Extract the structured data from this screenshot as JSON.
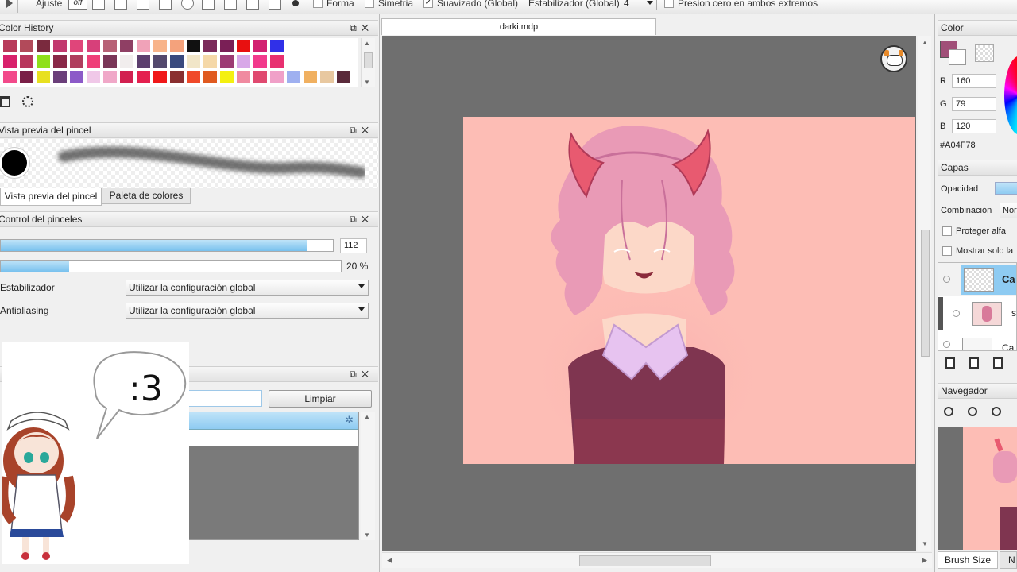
{
  "toolbar": {
    "ajuste": "Ajuste",
    "off": "off",
    "forma": "Forma",
    "simetria": "Simetria",
    "suavizado": "Suavizado (Global)",
    "estabilizador": "Estabilizador (Global)",
    "estabilizador_value": "4",
    "presion": "Presion cero en ambos extremos"
  },
  "color_history": {
    "title": "Color History",
    "colors": [
      [
        "#b83a5a",
        "#b24a5a",
        "#7a2a3e",
        "#c2396f",
        "#e0457a",
        "#d7407a",
        "#b76176",
        "#8f3f64",
        "#f0a2b8",
        "#f8b48a",
        "#f4a27c",
        "#111111",
        "#7b2a5a",
        "#7a1f56",
        "#e81010",
        "#d22070",
        "#3030e8"
      ],
      [
        "#d8216c",
        "#b8365c",
        "#8fe01a",
        "#8a2848",
        "#b03e5e",
        "#ef3f79",
        "#7a3658",
        "#f1eded",
        "#5c3f6e",
        "#54496e",
        "#3a4a7e",
        "#f1e6c8",
        "#f5d8a8",
        "#9d3b74",
        "#d8a8e8",
        "#f23a8c",
        "#e83070"
      ],
      [
        "#f24a8a",
        "#7a1f47",
        "#e8e020",
        "#6b3f7a",
        "#8c5ac8",
        "#f0c8e8",
        "#f0a8c8",
        "#d22050",
        "#e4204f",
        "#f0181a",
        "#8a2f30",
        "#f04a2a",
        "#e05a20",
        "#f4f010",
        "#f08aa0",
        "#e04a70",
        "#f0a0c8",
        "#9fb0f0",
        "#f0b060",
        "#e8c8a0",
        "#5a2a3a"
      ]
    ]
  },
  "brush_preview": {
    "title": "Vista previa del pincel",
    "tab_active": "Vista previa del pincel",
    "tab_other": "Paleta de colores"
  },
  "brush_control": {
    "title": "Control del pinceles",
    "size_value": "112",
    "size_percent": 92,
    "opacity_value": "20 %",
    "opacity_percent": 20,
    "estabilizador_label": "Estabilizador",
    "estabilizador_value": "Utilizar la configuración global",
    "antialiasing_label": "Antialiasing",
    "antialiasing_value": "Utilizar la configuración global"
  },
  "search_panel": {
    "clear_button": "Limpiar"
  },
  "overlay": {
    "speech": ":3"
  },
  "canvas": {
    "tab_title": "darki.mdp"
  },
  "color_panel": {
    "title": "Color",
    "r_label": "R",
    "r_value": "160",
    "g_label": "G",
    "g_value": "79",
    "b_label": "B",
    "b_value": "120",
    "hex": "#A04F78",
    "current_color": "#a04f78"
  },
  "layers_panel": {
    "title": "Capas",
    "opacity_label": "Opacidad",
    "blend_label": "Combinación",
    "blend_value": "Nor",
    "protect_alpha": "Proteger alfa",
    "show_only": "Mostrar solo la",
    "layer1": "Ca",
    "layer2": "sl",
    "layer3": "Ca"
  },
  "navigator": {
    "title": "Navegador"
  },
  "bottom_tabs": {
    "brush_size": "Brush Size",
    "next": "N"
  }
}
